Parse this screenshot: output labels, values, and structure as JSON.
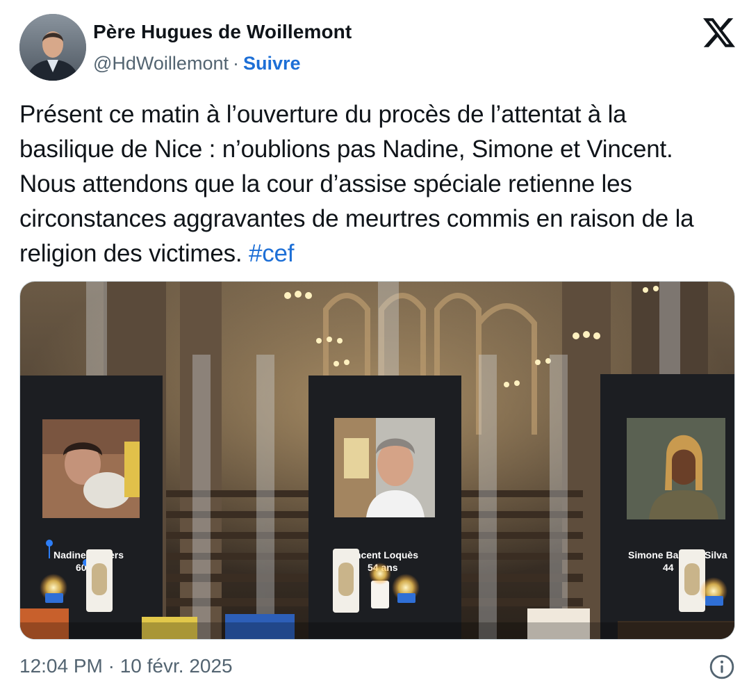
{
  "author": {
    "name": "Père Hugues de Woillemont",
    "handle": "@HdWoillemont",
    "separator": "·",
    "follow_label": "Suivre"
  },
  "tweet": {
    "text": "Présent ce matin à l’ouverture du procès de l’attentat à la basilique de Nice : n’oublions pas Nadine, Simone et Vincent. Nous attendons que la cour d’assise spéciale retienne les circonstances aggravantes de meurtres commis  en raison de la religion des victimes. ",
    "hashtag": "#cef"
  },
  "photo": {
    "left_panel_text": "Nadine",
    "left_panel_text_2": "ers",
    "left_panel_text_3": "60",
    "center_panel_name": "ncent Loquès",
    "center_panel_age": "54 ans",
    "right_panel_name_a": "Simone Ba",
    "right_panel_name_b": "Silva",
    "right_panel_age": "44"
  },
  "footer": {
    "timestamp": "12:04 PM · 10 févr. 2025"
  },
  "icons": {
    "x_logo": "x-logo-icon",
    "info": "info-icon"
  },
  "colors": {
    "accent": "#1d6fd6",
    "secondary_text": "#536471"
  }
}
